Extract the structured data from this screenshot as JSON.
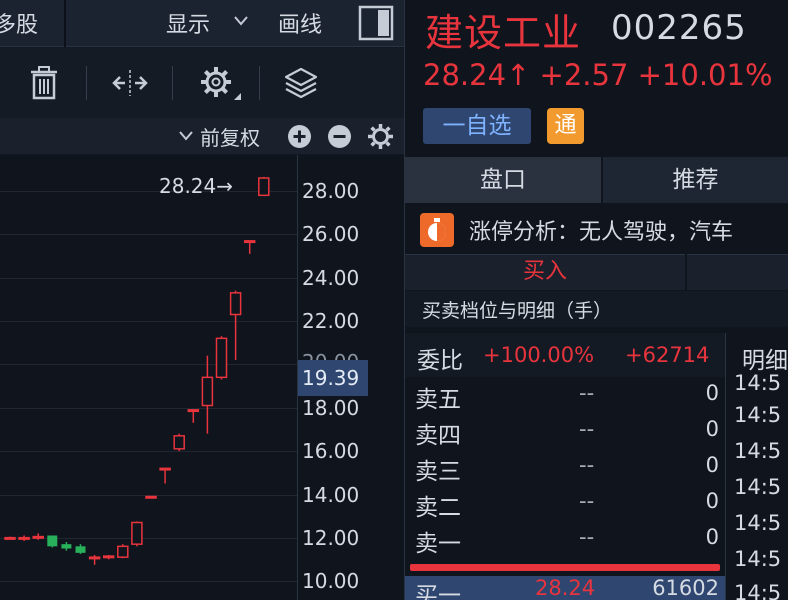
{
  "left_panel": {
    "topbar": {
      "partial_tab": "多股",
      "display_label": "显示",
      "drawline_label": "画线"
    },
    "toolbar": {
      "icons": [
        "trash-icon",
        "fit-width-icon",
        "settings-gear-icon",
        "layers-icon"
      ]
    },
    "chart_bar": {
      "adjust_label": "前复权"
    },
    "chart": {
      "price_annotation": "28.24→",
      "current_price_box": "19.39",
      "hidden_tick": "20.00"
    }
  },
  "chart_data": {
    "type": "candlestick",
    "yticks": [
      "28.00",
      "26.00",
      "24.00",
      "22.00",
      "18.00",
      "16.00",
      "14.00",
      "12.00",
      "10.00"
    ],
    "ylim": [
      9.8,
      29.0
    ],
    "grid": true,
    "candles": [
      {
        "o": 12.0,
        "c": 12.0,
        "h": 12.05,
        "l": 11.95,
        "dir": "up"
      },
      {
        "o": 11.95,
        "c": 12.0,
        "h": 12.1,
        "l": 11.85,
        "dir": "up"
      },
      {
        "o": 12.05,
        "c": 12.0,
        "h": 12.2,
        "l": 11.9,
        "dir": "up"
      },
      {
        "o": 12.1,
        "c": 11.6,
        "h": 12.1,
        "l": 11.55,
        "dir": "down"
      },
      {
        "o": 11.7,
        "c": 11.5,
        "h": 11.8,
        "l": 11.4,
        "dir": "down"
      },
      {
        "o": 11.6,
        "c": 11.3,
        "h": 11.7,
        "l": 11.25,
        "dir": "down"
      },
      {
        "o": 11.1,
        "c": 11.1,
        "h": 11.2,
        "l": 10.75,
        "dir": "up"
      },
      {
        "o": 11.1,
        "c": 11.15,
        "h": 11.2,
        "l": 11.0,
        "dir": "up"
      },
      {
        "o": 11.1,
        "c": 11.6,
        "h": 11.7,
        "l": 11.05,
        "dir": "up"
      },
      {
        "o": 11.7,
        "c": 12.7,
        "h": 12.75,
        "l": 11.6,
        "dir": "up"
      },
      {
        "o": 13.9,
        "c": 13.9,
        "h": 13.9,
        "l": 13.9,
        "dir": "up"
      },
      {
        "o": 15.2,
        "c": 15.2,
        "h": 15.2,
        "l": 14.5,
        "dir": "up"
      },
      {
        "o": 16.1,
        "c": 16.7,
        "h": 16.8,
        "l": 16.0,
        "dir": "up"
      },
      {
        "o": 17.9,
        "c": 17.9,
        "h": 17.9,
        "l": 17.3,
        "dir": "up"
      },
      {
        "o": 18.1,
        "c": 19.4,
        "h": 20.4,
        "l": 16.8,
        "dir": "up"
      },
      {
        "o": 19.4,
        "c": 21.2,
        "h": 21.3,
        "l": 19.3,
        "dir": "up"
      },
      {
        "o": 22.3,
        "c": 23.3,
        "h": 23.4,
        "l": 20.2,
        "dir": "up"
      },
      {
        "o": 25.7,
        "c": 25.7,
        "h": 25.7,
        "l": 25.1,
        "dir": "up"
      },
      {
        "o": 27.8,
        "c": 28.6,
        "h": 28.65,
        "l": 27.8,
        "dir": "up"
      }
    ]
  },
  "right_panel": {
    "stock": {
      "name": "建设工业",
      "code": "002265",
      "price_line": "28.24↑ +2.57 +10.01%"
    },
    "watch_button": "一自选",
    "tong_badge": "通",
    "tabs": [
      "盘口",
      "推荐"
    ],
    "zt_analysis": "涨停分析：无人驾驶，汽车",
    "buy_tab": "买入",
    "detail_title": "买卖档位与明细（手）",
    "ratio": {
      "label": "委比",
      "percent": "+100.00%",
      "diff": "+62714",
      "detail_label": "明细"
    },
    "book": [
      {
        "label": "卖五",
        "price": "--",
        "vol": "0"
      },
      {
        "label": "卖四",
        "price": "--",
        "vol": "0"
      },
      {
        "label": "卖三",
        "price": "--",
        "vol": "0"
      },
      {
        "label": "卖二",
        "price": "--",
        "vol": "0"
      },
      {
        "label": "卖一",
        "price": "--",
        "vol": "0"
      }
    ],
    "buy1": {
      "label": "买一",
      "price": "28.24",
      "vol": "61602"
    },
    "detail_times": [
      "14:5",
      "14:5",
      "14:5",
      "14:5",
      "14:5",
      "14:5",
      "14:5"
    ]
  },
  "colors": {
    "up": "#e8343d",
    "down": "#28b15a",
    "accent_blue": "#2e4670",
    "badge_orange": "#f29a2e"
  }
}
